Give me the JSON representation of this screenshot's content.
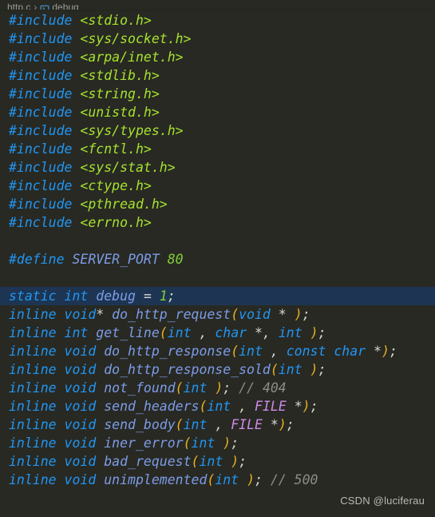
{
  "breadcrumb": {
    "file": "http.c",
    "separator": "›",
    "symbol_icon": "variable-symbol-icon",
    "symbol": "debug"
  },
  "editor": {
    "language": "c",
    "highlighted_line_index": 13,
    "colors": {
      "background": "#282923",
      "highlight_line": "#1d3552",
      "preprocessor": "#2196f3",
      "header_string": "#a6e22e",
      "keyword": "#2196f3",
      "identifier": "#7d9ce8",
      "number": "#82d13a",
      "punctuation": "#d8d8d2",
      "bracket": "#e8b122",
      "type": "#d08ae8",
      "comment": "#8b8d87"
    },
    "lines": [
      {
        "tokens": [
          {
            "t": "pre",
            "v": "#include"
          },
          {
            "t": "punct",
            "v": " "
          },
          {
            "t": "hdr",
            "v": "<stdio.h>"
          }
        ]
      },
      {
        "tokens": [
          {
            "t": "pre",
            "v": "#include"
          },
          {
            "t": "punct",
            "v": " "
          },
          {
            "t": "hdr",
            "v": "<sys/socket.h>"
          }
        ]
      },
      {
        "tokens": [
          {
            "t": "pre",
            "v": "#include"
          },
          {
            "t": "punct",
            "v": " "
          },
          {
            "t": "hdr",
            "v": "<arpa/inet.h>"
          }
        ]
      },
      {
        "tokens": [
          {
            "t": "pre",
            "v": "#include"
          },
          {
            "t": "punct",
            "v": " "
          },
          {
            "t": "hdr",
            "v": "<stdlib.h>"
          }
        ]
      },
      {
        "tokens": [
          {
            "t": "pre",
            "v": "#include"
          },
          {
            "t": "punct",
            "v": " "
          },
          {
            "t": "hdr",
            "v": "<string.h>"
          }
        ]
      },
      {
        "tokens": [
          {
            "t": "pre",
            "v": "#include"
          },
          {
            "t": "punct",
            "v": " "
          },
          {
            "t": "hdr",
            "v": "<unistd.h>"
          }
        ]
      },
      {
        "tokens": [
          {
            "t": "pre",
            "v": "#include"
          },
          {
            "t": "punct",
            "v": " "
          },
          {
            "t": "hdr",
            "v": "<sys/types.h>"
          }
        ]
      },
      {
        "tokens": [
          {
            "t": "pre",
            "v": "#include"
          },
          {
            "t": "punct",
            "v": " "
          },
          {
            "t": "hdr",
            "v": "<fcntl.h>"
          }
        ]
      },
      {
        "tokens": [
          {
            "t": "pre",
            "v": "#include"
          },
          {
            "t": "punct",
            "v": " "
          },
          {
            "t": "hdr",
            "v": "<sys/stat.h>"
          }
        ]
      },
      {
        "tokens": [
          {
            "t": "pre",
            "v": "#include"
          },
          {
            "t": "punct",
            "v": " "
          },
          {
            "t": "hdr",
            "v": "<ctype.h>"
          }
        ]
      },
      {
        "tokens": [
          {
            "t": "pre",
            "v": "#include"
          },
          {
            "t": "punct",
            "v": " "
          },
          {
            "t": "hdr",
            "v": "<pthread.h>"
          }
        ]
      },
      {
        "tokens": [
          {
            "t": "pre",
            "v": "#include"
          },
          {
            "t": "punct",
            "v": " "
          },
          {
            "t": "hdr",
            "v": "<errno.h>"
          }
        ]
      },
      {
        "tokens": []
      },
      {
        "tokens": [
          {
            "t": "pre",
            "v": "#define"
          },
          {
            "t": "punct",
            "v": " "
          },
          {
            "t": "ident",
            "v": "SERVER_PORT"
          },
          {
            "t": "punct",
            "v": " "
          },
          {
            "t": "num",
            "v": "80"
          }
        ]
      },
      {
        "tokens": []
      },
      {
        "highlight": true,
        "tokens": [
          {
            "t": "kw",
            "v": "static"
          },
          {
            "t": "punct",
            "v": " "
          },
          {
            "t": "kw",
            "v": "int"
          },
          {
            "t": "punct",
            "v": " "
          },
          {
            "t": "ident",
            "v": "debug"
          },
          {
            "t": "punct",
            "v": " = "
          },
          {
            "t": "num",
            "v": "1"
          },
          {
            "t": "punct",
            "v": ";"
          }
        ]
      },
      {
        "tokens": [
          {
            "t": "kw",
            "v": "inline"
          },
          {
            "t": "punct",
            "v": " "
          },
          {
            "t": "kw",
            "v": "void"
          },
          {
            "t": "punct",
            "v": "* "
          },
          {
            "t": "ident",
            "v": "do_http_request"
          },
          {
            "t": "brk",
            "v": "("
          },
          {
            "t": "kw",
            "v": "void"
          },
          {
            "t": "punct",
            "v": " * "
          },
          {
            "t": "brk",
            "v": ")"
          },
          {
            "t": "punct",
            "v": ";"
          }
        ]
      },
      {
        "tokens": [
          {
            "t": "kw",
            "v": "inline"
          },
          {
            "t": "punct",
            "v": " "
          },
          {
            "t": "kw",
            "v": "int"
          },
          {
            "t": "punct",
            "v": " "
          },
          {
            "t": "ident",
            "v": "get_line"
          },
          {
            "t": "brk",
            "v": "("
          },
          {
            "t": "kw",
            "v": "int"
          },
          {
            "t": "punct",
            "v": " , "
          },
          {
            "t": "kw",
            "v": "char"
          },
          {
            "t": "punct",
            "v": " *, "
          },
          {
            "t": "kw",
            "v": "int"
          },
          {
            "t": "punct",
            "v": " "
          },
          {
            "t": "brk",
            "v": ")"
          },
          {
            "t": "punct",
            "v": ";"
          }
        ]
      },
      {
        "tokens": [
          {
            "t": "kw",
            "v": "inline"
          },
          {
            "t": "punct",
            "v": " "
          },
          {
            "t": "kw",
            "v": "void"
          },
          {
            "t": "punct",
            "v": " "
          },
          {
            "t": "ident",
            "v": "do_http_response"
          },
          {
            "t": "brk",
            "v": "("
          },
          {
            "t": "kw",
            "v": "int"
          },
          {
            "t": "punct",
            "v": " , "
          },
          {
            "t": "kw",
            "v": "const"
          },
          {
            "t": "punct",
            "v": " "
          },
          {
            "t": "kw",
            "v": "char"
          },
          {
            "t": "punct",
            "v": " *"
          },
          {
            "t": "brk",
            "v": ")"
          },
          {
            "t": "punct",
            "v": ";"
          }
        ]
      },
      {
        "tokens": [
          {
            "t": "kw",
            "v": "inline"
          },
          {
            "t": "punct",
            "v": " "
          },
          {
            "t": "kw",
            "v": "void"
          },
          {
            "t": "punct",
            "v": " "
          },
          {
            "t": "ident",
            "v": "do_http_response_sold"
          },
          {
            "t": "brk",
            "v": "("
          },
          {
            "t": "kw",
            "v": "int"
          },
          {
            "t": "punct",
            "v": " "
          },
          {
            "t": "brk",
            "v": ")"
          },
          {
            "t": "punct",
            "v": ";"
          }
        ]
      },
      {
        "tokens": [
          {
            "t": "kw",
            "v": "inline"
          },
          {
            "t": "punct",
            "v": " "
          },
          {
            "t": "kw",
            "v": "void"
          },
          {
            "t": "punct",
            "v": " "
          },
          {
            "t": "ident",
            "v": "not_found"
          },
          {
            "t": "brk",
            "v": "("
          },
          {
            "t": "kw",
            "v": "int"
          },
          {
            "t": "punct",
            "v": " "
          },
          {
            "t": "brk",
            "v": ")"
          },
          {
            "t": "punct",
            "v": "; "
          },
          {
            "t": "cmt",
            "v": "// 404"
          }
        ]
      },
      {
        "tokens": [
          {
            "t": "kw",
            "v": "inline"
          },
          {
            "t": "punct",
            "v": " "
          },
          {
            "t": "kw",
            "v": "void"
          },
          {
            "t": "punct",
            "v": " "
          },
          {
            "t": "ident",
            "v": "send_headers"
          },
          {
            "t": "brk",
            "v": "("
          },
          {
            "t": "kw",
            "v": "int"
          },
          {
            "t": "punct",
            "v": " , "
          },
          {
            "t": "type",
            "v": "FILE"
          },
          {
            "t": "punct",
            "v": " *"
          },
          {
            "t": "brk",
            "v": ")"
          },
          {
            "t": "punct",
            "v": ";"
          }
        ]
      },
      {
        "tokens": [
          {
            "t": "kw",
            "v": "inline"
          },
          {
            "t": "punct",
            "v": " "
          },
          {
            "t": "kw",
            "v": "void"
          },
          {
            "t": "punct",
            "v": " "
          },
          {
            "t": "ident",
            "v": "send_body"
          },
          {
            "t": "brk",
            "v": "("
          },
          {
            "t": "kw",
            "v": "int"
          },
          {
            "t": "punct",
            "v": " , "
          },
          {
            "t": "type",
            "v": "FILE"
          },
          {
            "t": "punct",
            "v": " *"
          },
          {
            "t": "brk",
            "v": ")"
          },
          {
            "t": "punct",
            "v": ";"
          }
        ]
      },
      {
        "tokens": [
          {
            "t": "kw",
            "v": "inline"
          },
          {
            "t": "punct",
            "v": " "
          },
          {
            "t": "kw",
            "v": "void"
          },
          {
            "t": "punct",
            "v": " "
          },
          {
            "t": "ident",
            "v": "iner_error"
          },
          {
            "t": "brk",
            "v": "("
          },
          {
            "t": "kw",
            "v": "int"
          },
          {
            "t": "punct",
            "v": " "
          },
          {
            "t": "brk",
            "v": ")"
          },
          {
            "t": "punct",
            "v": ";"
          }
        ]
      },
      {
        "tokens": [
          {
            "t": "kw",
            "v": "inline"
          },
          {
            "t": "punct",
            "v": " "
          },
          {
            "t": "kw",
            "v": "void"
          },
          {
            "t": "punct",
            "v": " "
          },
          {
            "t": "ident",
            "v": "bad_request"
          },
          {
            "t": "brk",
            "v": "("
          },
          {
            "t": "kw",
            "v": "int"
          },
          {
            "t": "punct",
            "v": " "
          },
          {
            "t": "brk",
            "v": ")"
          },
          {
            "t": "punct",
            "v": ";"
          }
        ]
      },
      {
        "tokens": [
          {
            "t": "kw",
            "v": "inline"
          },
          {
            "t": "punct",
            "v": " "
          },
          {
            "t": "kw",
            "v": "void"
          },
          {
            "t": "punct",
            "v": " "
          },
          {
            "t": "ident",
            "v": "unimplemented"
          },
          {
            "t": "brk",
            "v": "("
          },
          {
            "t": "kw",
            "v": "int"
          },
          {
            "t": "punct",
            "v": " "
          },
          {
            "t": "brk",
            "v": ")"
          },
          {
            "t": "punct",
            "v": "; "
          },
          {
            "t": "cmt",
            "v": "// 500"
          }
        ]
      }
    ]
  },
  "watermark": {
    "text": "CSDN @luciferau"
  }
}
